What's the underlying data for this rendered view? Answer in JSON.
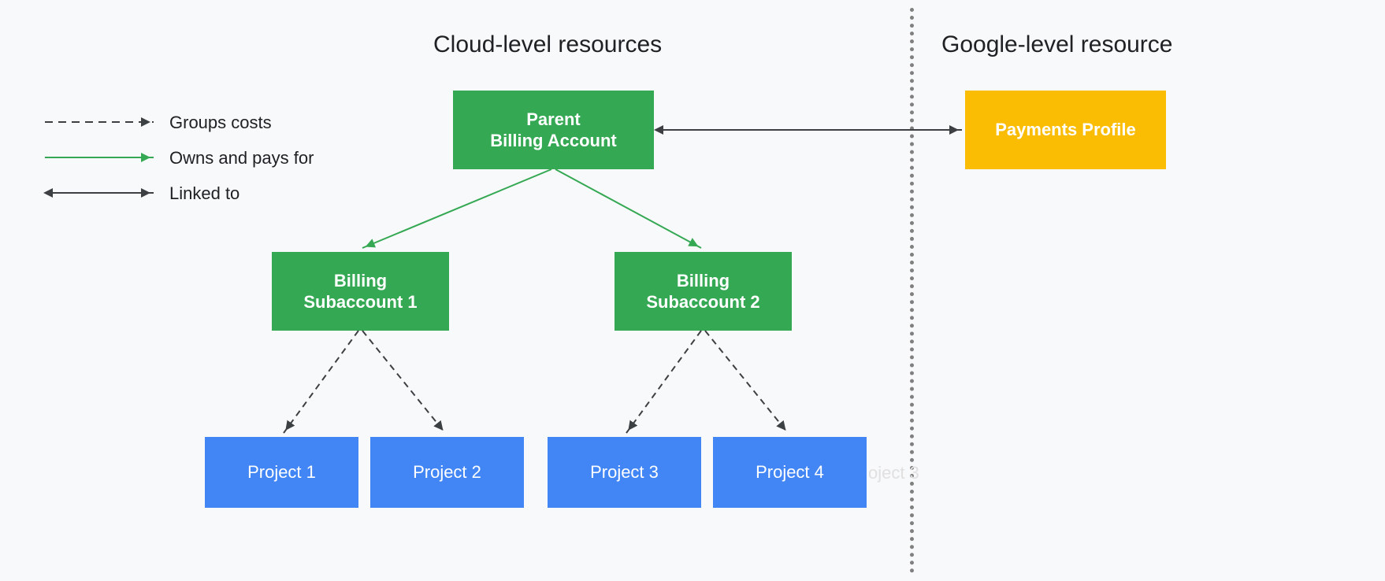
{
  "headings": {
    "cloud": "Cloud-level resources",
    "google": "Google-level resource"
  },
  "nodes": {
    "parent": {
      "line1": "Parent",
      "line2": "Billing Account"
    },
    "sub1": {
      "line1": "Billing",
      "line2": "Subaccount 1"
    },
    "sub2": {
      "line1": "Billing",
      "line2": "Subaccount 2"
    },
    "p1": "Project 1",
    "p2": "Project 2",
    "p3": "Project 3",
    "p4": "Project 4",
    "payments": "Payments Profile",
    "ghost": "oject 3"
  },
  "legend": {
    "groups": "Groups costs",
    "owns": "Owns and pays for",
    "linked": "Linked to"
  },
  "colors": {
    "green": "#34a853",
    "yellow": "#fbbc04",
    "blue": "#4285f4",
    "arrow_dark": "#3c4043"
  }
}
